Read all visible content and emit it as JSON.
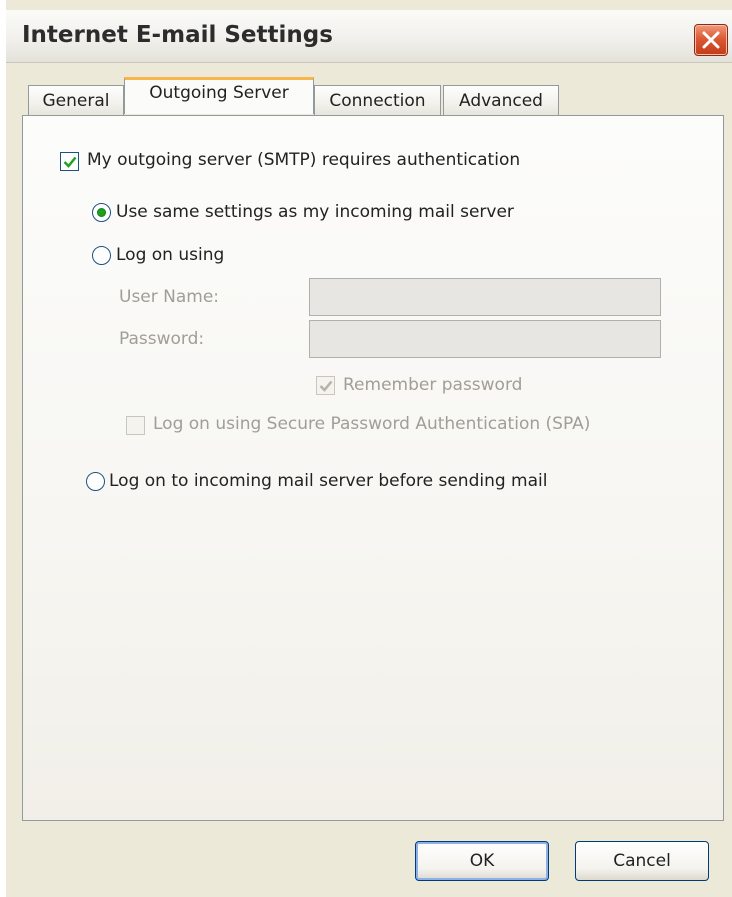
{
  "window": {
    "title": "Internet E-mail Settings"
  },
  "tabs": [
    {
      "label": "General",
      "active": false
    },
    {
      "label": "Outgoing Server",
      "active": true
    },
    {
      "label": "Connection",
      "active": false
    },
    {
      "label": "Advanced",
      "active": false
    }
  ],
  "outgoing": {
    "smtp_auth": {
      "label": "My outgoing server (SMTP) requires authentication",
      "checked": true
    },
    "same_settings": {
      "label": "Use same settings as my incoming mail server",
      "selected": true
    },
    "log_on_using": {
      "label": "Log on using",
      "selected": false
    },
    "user_name": {
      "label": "User Name:",
      "value": ""
    },
    "password": {
      "label": "Password:",
      "value": ""
    },
    "remember_password": {
      "label": "Remember password",
      "checked": true,
      "enabled": false
    },
    "spa": {
      "label": "Log on using Secure Password Authentication (SPA)",
      "checked": false,
      "enabled": false
    },
    "log_on_incoming": {
      "label": "Log on to incoming mail server before sending mail",
      "selected": false
    }
  },
  "buttons": {
    "ok": "OK",
    "cancel": "Cancel"
  },
  "colors": {
    "accent_tab": "#f7b64a",
    "close_button": "#dc5a35",
    "radio_selected": "#21a121",
    "checkmark": "#21a121"
  },
  "icons": {
    "close": "close-icon",
    "check": "checkmark-icon"
  }
}
